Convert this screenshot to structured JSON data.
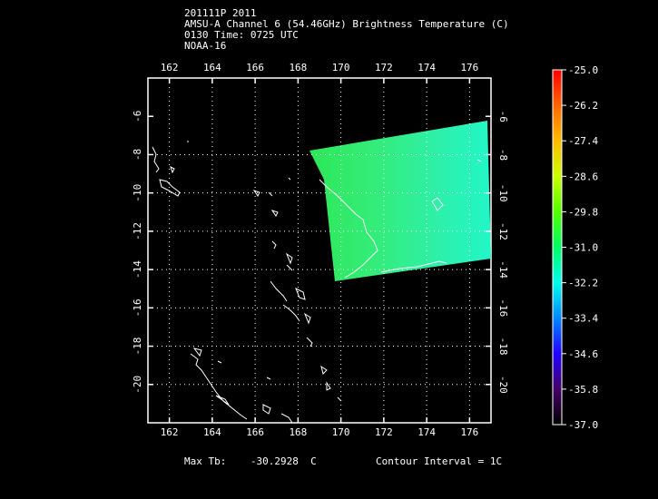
{
  "header": {
    "line1": "201111P 2011",
    "line2": "AMSU-A Channel 6 (54.46GHz) Brightness Temperature (C)",
    "line3": "0130 Time: 0725 UTC",
    "line4": "NOAA-16"
  },
  "map": {
    "lon_ticks": [
      "162",
      "164",
      "166",
      "168",
      "170",
      "172",
      "174",
      "176"
    ],
    "lat_ticks": [
      "-8",
      "-10",
      "-12",
      "-14",
      "-16",
      "-18",
      "-20"
    ],
    "lat_ticks_top_right": "-6",
    "lon_range": [
      161,
      177
    ],
    "lat_range": [
      -22,
      -4
    ],
    "swath_color_center": "#33ee66",
    "swath_color_edge": "#22ffcc",
    "coastline_color": "#ffffff",
    "grid_color": "#ffffff"
  },
  "colorbar": {
    "labels": [
      "-25.0",
      "-26.2",
      "-27.4",
      "-28.6",
      "-29.8",
      "-31.0",
      "-32.2",
      "-33.4",
      "-34.6",
      "-35.8",
      "-37.0"
    ]
  },
  "footer": {
    "max_tb_label": "Max Tb:",
    "max_tb_value": "-30.2928",
    "max_tb_unit": "C",
    "contour_interval": "Contour Interval = 1C"
  }
}
